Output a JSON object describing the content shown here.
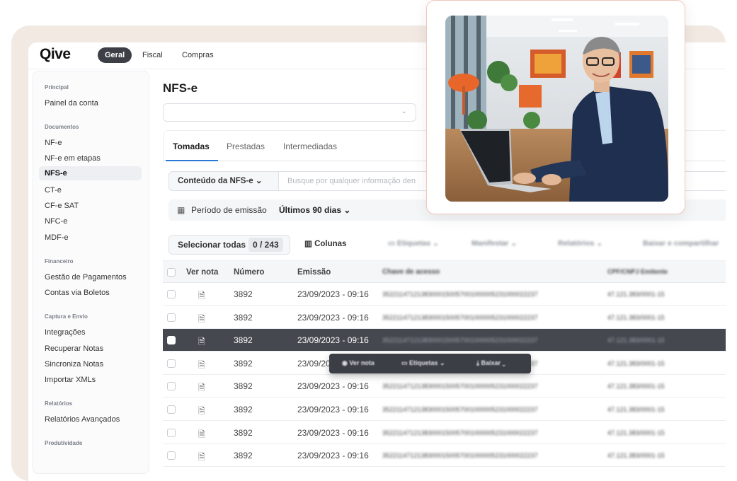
{
  "brand": {
    "logo": "Qive"
  },
  "nav": {
    "tabs": [
      "Geral",
      "Fiscal",
      "Compras"
    ],
    "active": "Geral"
  },
  "sidebar": {
    "sections": [
      {
        "title": "Principal",
        "items": [
          "Painel da conta"
        ]
      },
      {
        "title": "Documentos",
        "items": [
          "NF-e",
          "NF-e em etapas",
          "NFS-e",
          "CT-e",
          "CF-e SAT",
          "NFC-e",
          "MDF-e"
        ]
      },
      {
        "title": "Financeiro",
        "items": [
          "Gestão de Pagamentos",
          "Contas via Boletos"
        ]
      },
      {
        "title": "Captura e Envio",
        "items": [
          "Integrações",
          "Recuperar Notas",
          "Sincroniza Notas",
          "Importar XMLs"
        ]
      },
      {
        "title": "Relatórios",
        "items": [
          "Relatórios Avançados"
        ]
      },
      {
        "title": "Produtividade",
        "items": []
      }
    ],
    "active_item": "NFS-e"
  },
  "main": {
    "title": "NFS-e",
    "tabs": [
      "Tomadas",
      "Prestadas",
      "Intermediadas"
    ],
    "active_tab": "Tomadas",
    "content_filter": "Conteúdo da NFS-e",
    "search_placeholder": "Busque por qualquer informação den",
    "period_label": "Período de emissão",
    "period_value": "Últimos 90 dias",
    "select_all": "Selecionar todas",
    "selection_count": "0 / 243",
    "columns_btn": "Colunas",
    "toolbar_blurred": [
      "Etiquetas",
      "Manifestar",
      "Relatórios",
      "Baixar e compartilhar"
    ]
  },
  "table": {
    "headers": [
      "Ver nota",
      "Número",
      "Emissão",
      "Chave de acesso",
      "CPF/CNPJ Emitente"
    ],
    "rows": [
      {
        "numero": "3892",
        "emissao": "23/09/2023 - 09:16",
        "chave": "35221147121383000150057001000005231000022237",
        "cnpj": "47.121.383/0001-15"
      },
      {
        "numero": "3892",
        "emissao": "23/09/2023 - 09:16",
        "chave": "35221147121383000150057001000005231000022237",
        "cnpj": "47.121.383/0001-15"
      },
      {
        "numero": "3892",
        "emissao": "23/09/2023 - 09:16",
        "chave": "35221147121383000150057001000005231000022237",
        "cnpj": "47.121.383/0001-15"
      },
      {
        "numero": "3892",
        "emissao": "23/09/2023 - 09:16",
        "chave": "35221147121383000150057001000005231000022237",
        "cnpj": "47.121.383/0001-15"
      },
      {
        "numero": "3892",
        "emissao": "23/09/2023 - 09:16",
        "chave": "35221147121383000150057001000005231000022237",
        "cnpj": "47.121.383/0001-15"
      },
      {
        "numero": "3892",
        "emissao": "23/09/2023 - 09:16",
        "chave": "35221147121383000150057001000005231000022237",
        "cnpj": "47.121.383/0001-15"
      },
      {
        "numero": "3892",
        "emissao": "23/09/2023 - 09:16",
        "chave": "35221147121383000150057001000005231000022237",
        "cnpj": "47.121.383/0001-15"
      },
      {
        "numero": "3892",
        "emissao": "23/09/2023 - 09:16",
        "chave": "35221147121383000150057001000005231000022237",
        "cnpj": "47.121.383/0001-15"
      }
    ],
    "highlighted_row": 2
  },
  "row_popup": {
    "items": [
      "Ver nota",
      "Etiquetas",
      "Baixar"
    ]
  },
  "colors": {
    "accent": "#2a78d6",
    "frame": "#f1e9e2",
    "dark_row": "#45484f"
  }
}
